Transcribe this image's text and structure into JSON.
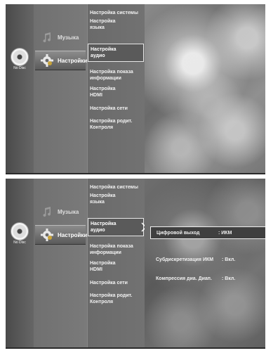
{
  "disc": {
    "label": "No Disc"
  },
  "menu": {
    "music_label": "Музыка",
    "settings_label": "Настройки"
  },
  "submenu": [
    "Настройка системы",
    "Настройка языка",
    "Настройка аудио",
    "Настройка показа информации",
    "Настройка HDMI",
    "Настройка сети",
    "Настройка родит. Контроля"
  ],
  "submenu_lines": {
    "system": "Настройка системы",
    "lang_1": "Настройка",
    "lang_2": "языка",
    "audio_1": "Настройка",
    "audio_2": "аудио",
    "info_1": "Настройка показа",
    "info_2": "информации",
    "hdmi_1": "Настройка",
    "hdmi_2": "HDMI",
    "network": "Настройка сети",
    "parent_1": "Настройка родит.",
    "parent_2": "Контроля"
  },
  "audio_options": {
    "digital_out_label": "Цифровой выход",
    "digital_out_value": ": ИКМ",
    "pcm_down_label": "Субдискретизация ИКМ",
    "pcm_down_value": ": Вкл.",
    "drc_label": "Компрессия диа. Диап.",
    "drc_value": ": Вкл."
  },
  "colors": {
    "selection_border": "#efefef",
    "text": "#ffffff"
  }
}
